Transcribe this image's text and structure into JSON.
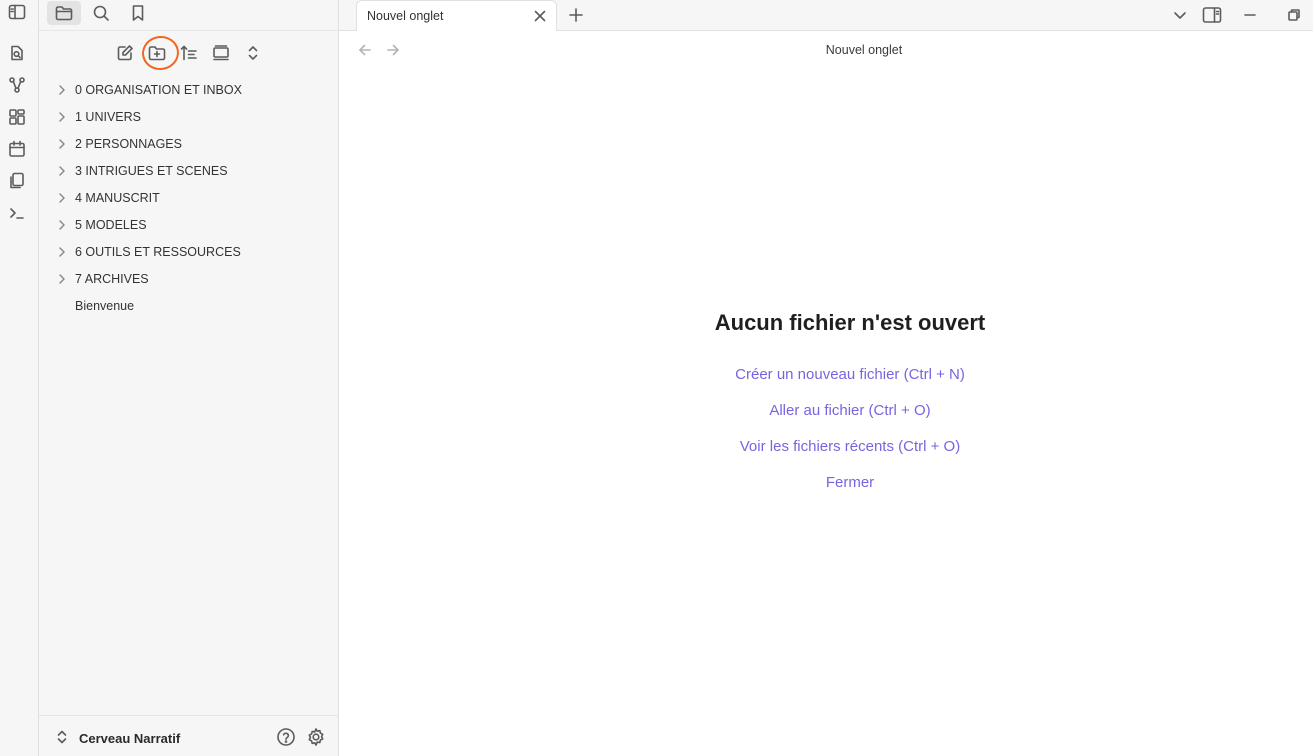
{
  "ribbon": {
    "icons": [
      "sidebar-toggle-icon",
      "open-quick-switcher-icon",
      "graph-view-icon",
      "canvas-icon",
      "daily-note-icon",
      "templates-icon",
      "command-palette-icon"
    ]
  },
  "sidebar": {
    "header_tabs": [
      "files-icon",
      "search-icon",
      "bookmarks-icon"
    ],
    "toolbar_icons": [
      "new-note-icon",
      "new-folder-icon",
      "sort-icon",
      "collapse-icon",
      "expand-icon"
    ],
    "tree": [
      {
        "label": "0 ORGANISATION ET INBOX",
        "folder": true
      },
      {
        "label": "1 UNIVERS",
        "folder": true
      },
      {
        "label": "2 PERSONNAGES",
        "folder": true
      },
      {
        "label": "3 INTRIGUES ET SCENES",
        "folder": true
      },
      {
        "label": "4 MANUSCRIT",
        "folder": true
      },
      {
        "label": "5 MODELES",
        "folder": true
      },
      {
        "label": "6 OUTILS ET RESSOURCES",
        "folder": true
      },
      {
        "label": "7 ARCHIVES",
        "folder": true
      },
      {
        "label": "Bienvenue",
        "folder": false
      }
    ],
    "footer": {
      "vault_name": "Cerveau Narratif"
    }
  },
  "tabs": [
    {
      "title": "Nouvel onglet",
      "active": true
    }
  ],
  "main": {
    "view_title": "Nouvel onglet",
    "empty_title": "Aucun fichier n'est ouvert",
    "actions": [
      "Créer un nouveau fichier (Ctrl + N)",
      "Aller au fichier (Ctrl + O)",
      "Voir les fichiers récents (Ctrl + O)",
      "Fermer"
    ]
  },
  "colors": {
    "accent": "#7b63e0",
    "highlight": "#f26522",
    "sidebar_bg": "#f6f6f6"
  }
}
